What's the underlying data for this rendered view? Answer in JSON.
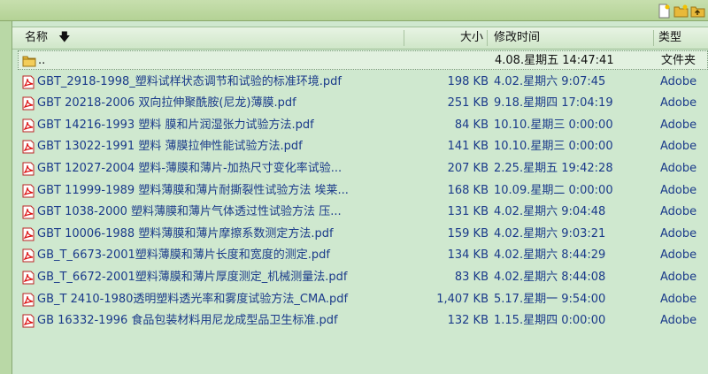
{
  "columns": {
    "name": "名称",
    "size": "大小",
    "date": "修改时间",
    "type": "类型"
  },
  "toolbar": {
    "icons": [
      "new-file-icon",
      "new-folder-icon",
      "folder-up-icon"
    ]
  },
  "files": [
    {
      "name": "..",
      "size": "",
      "date": "4.08.星期五 14:47:41",
      "type": "文件夹",
      "kind": "folder"
    },
    {
      "name": "GBT_2918-1998_塑料试样状态调节和试验的标准环境.pdf",
      "size": "198 KB",
      "date": "4.02.星期六 9:07:45",
      "type": "Adobe",
      "kind": "pdf"
    },
    {
      "name": "GBT 20218-2006 双向拉伸聚酰胺(尼龙)薄膜.pdf",
      "size": "251 KB",
      "date": "9.18.星期四 17:04:19",
      "type": "Adobe",
      "kind": "pdf"
    },
    {
      "name": "GBT 14216-1993 塑料 膜和片润湿张力试验方法.pdf",
      "size": "84 KB",
      "date": "10.10.星期三 0:00:00",
      "type": "Adobe",
      "kind": "pdf"
    },
    {
      "name": "GBT 13022-1991 塑料 薄膜拉伸性能试验方法.pdf",
      "size": "141 KB",
      "date": "10.10.星期三 0:00:00",
      "type": "Adobe",
      "kind": "pdf"
    },
    {
      "name": "GBT 12027-2004 塑料-薄膜和薄片-加热尺寸变化率试验...",
      "size": "207 KB",
      "date": "2.25.星期五 19:42:28",
      "type": "Adobe",
      "kind": "pdf"
    },
    {
      "name": "GBT 11999-1989 塑料薄膜和薄片耐撕裂性试验方法 埃莱...",
      "size": "168 KB",
      "date": "10.09.星期二 0:00:00",
      "type": "Adobe",
      "kind": "pdf"
    },
    {
      "name": "GBT 1038-2000 塑料薄膜和薄片气体透过性试验方法 压...",
      "size": "131 KB",
      "date": "4.02.星期六 9:04:48",
      "type": "Adobe",
      "kind": "pdf"
    },
    {
      "name": "GBT 10006-1988 塑料薄膜和薄片摩擦系数测定方法.pdf",
      "size": "159 KB",
      "date": "4.02.星期六 9:03:21",
      "type": "Adobe",
      "kind": "pdf"
    },
    {
      "name": "GB_T_6673-2001塑料薄膜和薄片长度和宽度的测定.pdf",
      "size": "134 KB",
      "date": "4.02.星期六 8:44:29",
      "type": "Adobe",
      "kind": "pdf"
    },
    {
      "name": "GB_T_6672-2001塑料薄膜和薄片厚度测定_机械测量法.pdf",
      "size": "83 KB",
      "date": "4.02.星期六 8:44:08",
      "type": "Adobe",
      "kind": "pdf"
    },
    {
      "name": "GB_T 2410-1980透明塑料透光率和雾度试验方法_CMA.pdf",
      "size": "1,407 KB",
      "date": "5.17.星期一 9:54:00",
      "type": "Adobe",
      "kind": "pdf"
    },
    {
      "name": "GB 16332-1996 食品包装材料用尼龙成型品卫生标准.pdf",
      "size": "132 KB",
      "date": "1.15.星期四 0:00:00",
      "type": "Adobe",
      "kind": "pdf"
    }
  ]
}
